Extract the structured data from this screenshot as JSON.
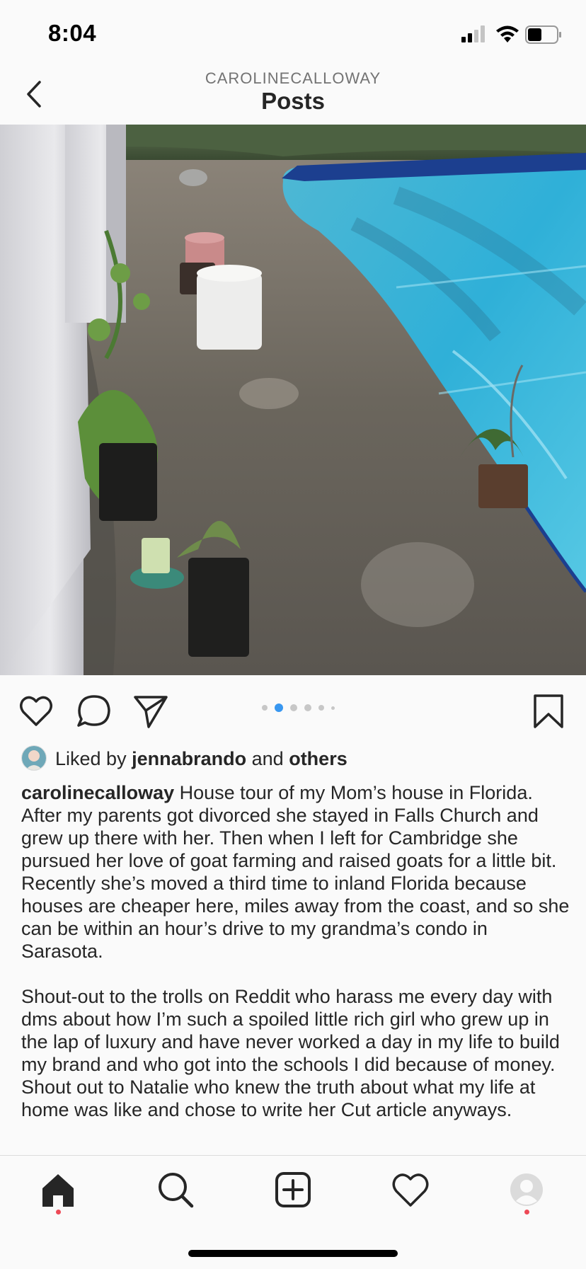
{
  "status_bar": {
    "time": "8:04",
    "icons": [
      "signal-icon",
      "wifi-icon",
      "battery-icon"
    ]
  },
  "header": {
    "username": "CAROLINECALLOWAY",
    "title": "Posts",
    "back_icon": "chevron-left-icon"
  },
  "post": {
    "actions": [
      "heart-icon",
      "comment-icon",
      "send-icon",
      "bookmark-icon"
    ],
    "carousel": {
      "count": 6,
      "active_index": 1,
      "active_color": "#3897f0"
    },
    "likes": {
      "prefix": "Liked by",
      "user": "jennabrando",
      "conjunction": "and",
      "others": "others"
    },
    "caption": {
      "username": "carolinecalloway",
      "paragraph1": "House tour of my Mom’s house in Florida. After my parents got divorced she stayed in Falls Church and grew up there with her. Then when I left for Cambridge she pursued her love of goat farming and raised goats for a little bit. Recently she’s moved a third time to inland Florida because houses are cheaper here, miles away from the coast, and so she can be within an hour’s drive to my grandma’s condo in Sarasota.",
      "paragraph2": "Shout-out to the trolls on Reddit who harass me every day with dms about how I’m such a spoiled little rich girl who grew up in the lap of luxury and have never worked a day in my life to build my brand and who got into the schools I did because of money. Shout out to Natalie who knew the truth about what my life at home was like and chose to write her Cut article anyways."
    }
  },
  "tab_bar": {
    "tabs": [
      "home-icon",
      "search-icon",
      "new-post-icon",
      "activity-icon",
      "profile-icon"
    ],
    "notification_color": "#ed4956"
  },
  "colors": {
    "background": "#fafafa",
    "text": "#262626",
    "secondary_text": "#737373",
    "accent": "#3897f0"
  }
}
